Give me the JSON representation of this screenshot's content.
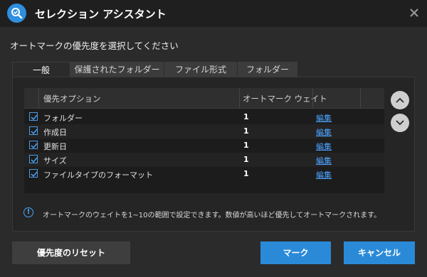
{
  "window": {
    "title": "セレクション アシスタント"
  },
  "prompt": "オートマークの優先度を選択してください",
  "tabs": [
    {
      "label": "一般",
      "active": true
    },
    {
      "label": "保護されたフォルダー",
      "active": false
    },
    {
      "label": "ファイル形式",
      "active": false
    },
    {
      "label": "フォルダー",
      "active": false
    }
  ],
  "table": {
    "headers": {
      "option": "優先オプション",
      "weight": "オートマーク ウェイト"
    },
    "rows": [
      {
        "checked": true,
        "name": "フォルダー",
        "weight": "1",
        "action": "編集"
      },
      {
        "checked": true,
        "name": "作成日",
        "weight": "1",
        "action": "編集"
      },
      {
        "checked": true,
        "name": "更新日",
        "weight": "1",
        "action": "編集"
      },
      {
        "checked": true,
        "name": "サイズ",
        "weight": "1",
        "action": "編集"
      },
      {
        "checked": true,
        "name": "ファイルタイプのフォーマット",
        "weight": "1",
        "action": "編集"
      }
    ]
  },
  "info": {
    "icon": "info-icon",
    "text": "オートマークのウェイトを1~10の範囲で設定できます。数値が高いほど優先してオートマークされます。"
  },
  "buttons": {
    "reset": "優先度のリセット",
    "mark": "マーク",
    "cancel": "キャンセル"
  },
  "colors": {
    "accent": "#2b8ad8",
    "link": "#4da3ff",
    "background": "#2b2b2b",
    "titlebar": "#1f1f1f"
  }
}
